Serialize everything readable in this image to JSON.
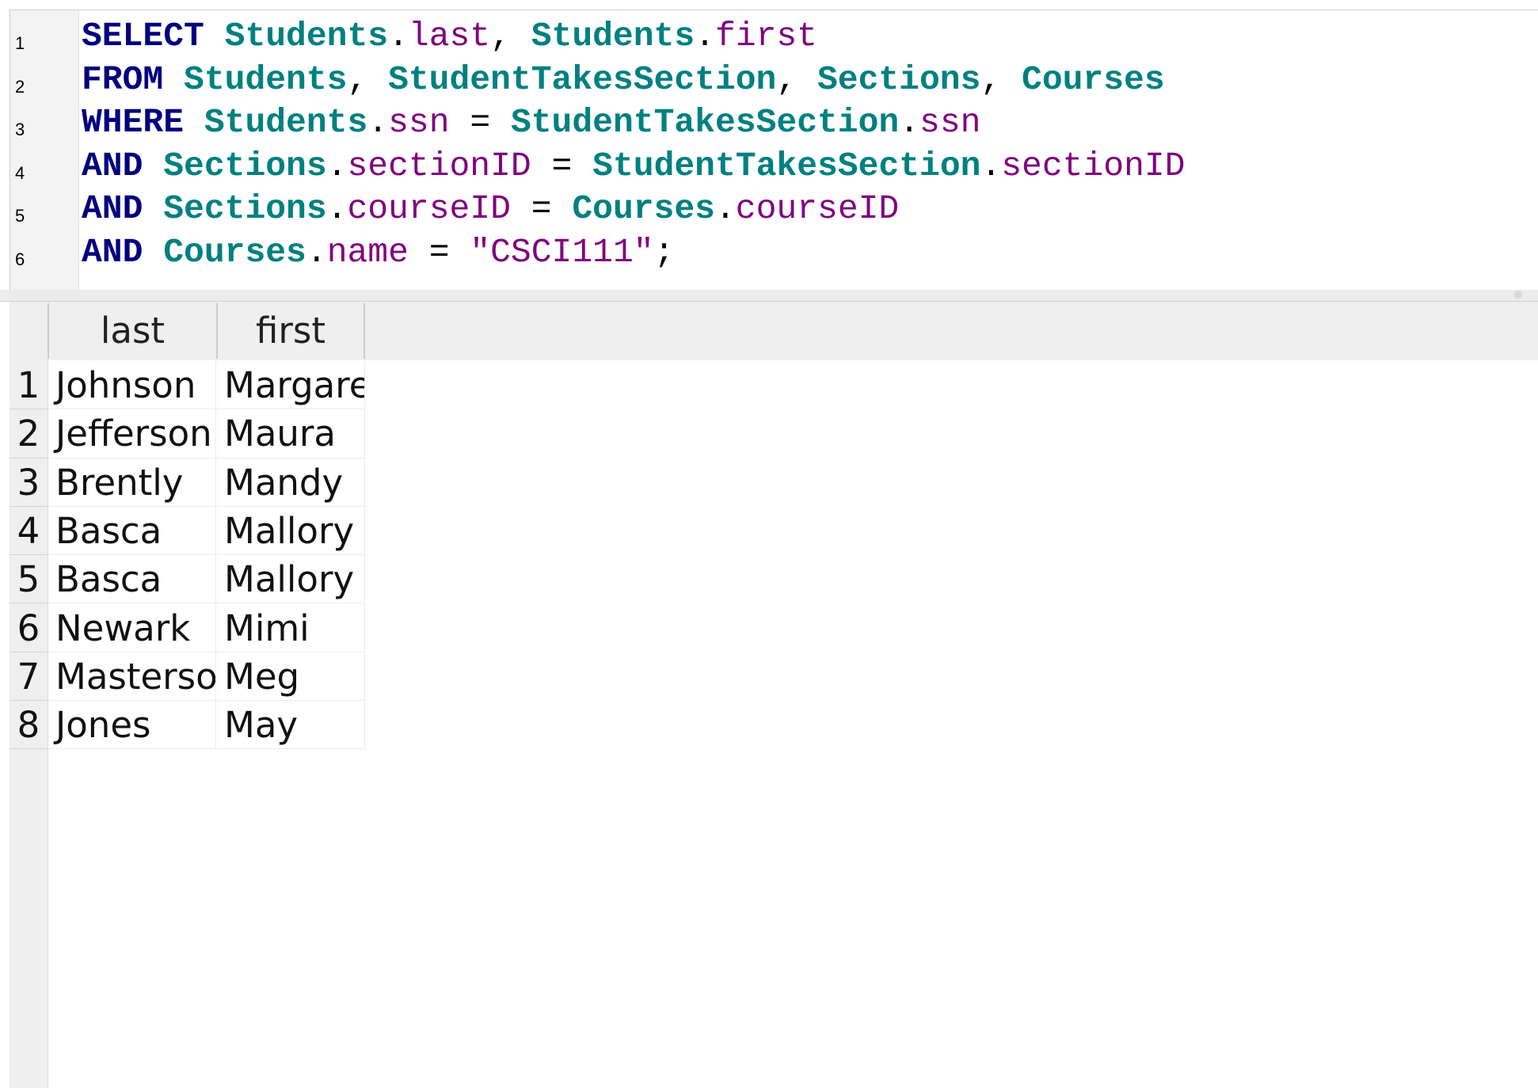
{
  "editor": {
    "line_numbers": [
      "1",
      "2",
      "3",
      "4",
      "5",
      "6"
    ],
    "lines": [
      [
        {
          "t": "SELECT",
          "c": "kw"
        },
        {
          "t": " ",
          "c": "pun"
        },
        {
          "t": "Students",
          "c": "tbl"
        },
        {
          "t": ".",
          "c": "pun"
        },
        {
          "t": "last",
          "c": "col"
        },
        {
          "t": ", ",
          "c": "pun"
        },
        {
          "t": "Students",
          "c": "tbl"
        },
        {
          "t": ".",
          "c": "pun"
        },
        {
          "t": "first",
          "c": "col"
        }
      ],
      [
        {
          "t": "FROM",
          "c": "kw"
        },
        {
          "t": " ",
          "c": "pun"
        },
        {
          "t": "Students",
          "c": "tbl"
        },
        {
          "t": ", ",
          "c": "pun"
        },
        {
          "t": "StudentTakesSection",
          "c": "tbl"
        },
        {
          "t": ", ",
          "c": "pun"
        },
        {
          "t": "Sections",
          "c": "tbl"
        },
        {
          "t": ", ",
          "c": "pun"
        },
        {
          "t": "Courses",
          "c": "tbl"
        }
      ],
      [
        {
          "t": "WHERE",
          "c": "kw"
        },
        {
          "t": " ",
          "c": "pun"
        },
        {
          "t": "Students",
          "c": "tbl"
        },
        {
          "t": ".",
          "c": "pun"
        },
        {
          "t": "ssn",
          "c": "col"
        },
        {
          "t": " = ",
          "c": "pun"
        },
        {
          "t": "StudentTakesSection",
          "c": "tbl"
        },
        {
          "t": ".",
          "c": "pun"
        },
        {
          "t": "ssn",
          "c": "col"
        }
      ],
      [
        {
          "t": "AND",
          "c": "kw"
        },
        {
          "t": " ",
          "c": "pun"
        },
        {
          "t": "Sections",
          "c": "tbl"
        },
        {
          "t": ".",
          "c": "pun"
        },
        {
          "t": "sectionID",
          "c": "col"
        },
        {
          "t": " = ",
          "c": "pun"
        },
        {
          "t": "StudentTakesSection",
          "c": "tbl"
        },
        {
          "t": ".",
          "c": "pun"
        },
        {
          "t": "sectionID",
          "c": "col"
        }
      ],
      [
        {
          "t": "AND",
          "c": "kw"
        },
        {
          "t": " ",
          "c": "pun"
        },
        {
          "t": "Sections",
          "c": "tbl"
        },
        {
          "t": ".",
          "c": "pun"
        },
        {
          "t": "courseID",
          "c": "col"
        },
        {
          "t": " = ",
          "c": "pun"
        },
        {
          "t": "Courses",
          "c": "tbl"
        },
        {
          "t": ".",
          "c": "pun"
        },
        {
          "t": "courseID",
          "c": "col"
        }
      ],
      [
        {
          "t": "AND",
          "c": "kw"
        },
        {
          "t": " ",
          "c": "pun"
        },
        {
          "t": "Courses",
          "c": "tbl"
        },
        {
          "t": ".",
          "c": "pun"
        },
        {
          "t": "name",
          "c": "col"
        },
        {
          "t": " = ",
          "c": "pun"
        },
        {
          "t": "\"CSCI111\"",
          "c": "str"
        },
        {
          "t": ";",
          "c": "pun"
        }
      ]
    ],
    "colors": {
      "keyword": "#000080",
      "table": "#008080",
      "column": "#800080",
      "string": "#800080"
    }
  },
  "results": {
    "columns": [
      "last",
      "first"
    ],
    "rows": [
      {
        "num": "1",
        "last": "Johnson",
        "first": "Margaret"
      },
      {
        "num": "2",
        "last": "Jefferson",
        "first": "Maura"
      },
      {
        "num": "3",
        "last": "Brently",
        "first": "Mandy"
      },
      {
        "num": "4",
        "last": "Basca",
        "first": "Mallory"
      },
      {
        "num": "5",
        "last": "Basca",
        "first": "Mallory"
      },
      {
        "num": "6",
        "last": "Newark",
        "first": "Mimi"
      },
      {
        "num": "7",
        "last": "Masterson",
        "first": "Meg"
      },
      {
        "num": "8",
        "last": "Jones",
        "first": "May"
      }
    ]
  }
}
